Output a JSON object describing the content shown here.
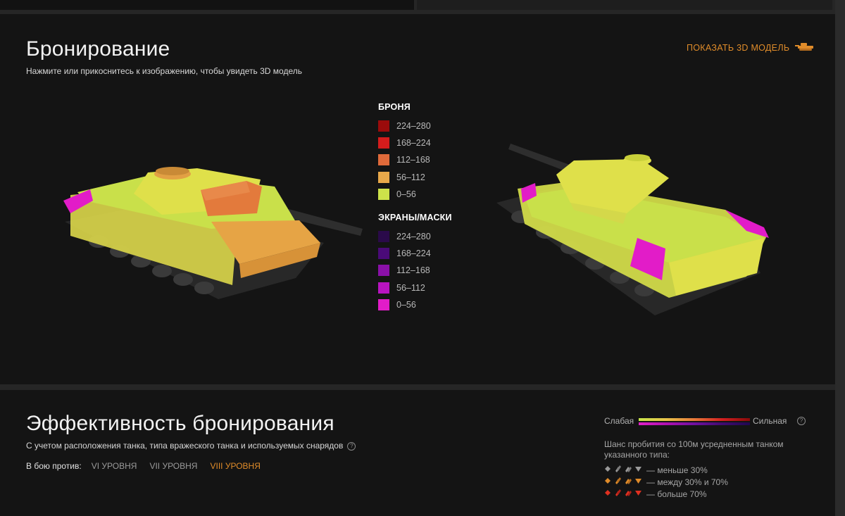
{
  "armor": {
    "title": "Бронирование",
    "subtitle": "Нажмите или прикоснитесь к изображению, чтобы увидеть 3D модель",
    "show_3d_label": "ПОКАЗАТЬ 3D МОДЕЛЬ",
    "legend_armor_title": "БРОНЯ",
    "legend_armor": [
      {
        "label": "224–280",
        "color": "#9b0b0b"
      },
      {
        "label": "168–224",
        "color": "#d41c1c"
      },
      {
        "label": "112–168",
        "color": "#e06a3a"
      },
      {
        "label": "56–112",
        "color": "#e8a84a"
      },
      {
        "label": "0–56",
        "color": "#cde24a"
      }
    ],
    "legend_screens_title": "ЭКРАНЫ/МАСКИ",
    "legend_screens": [
      {
        "label": "224–280",
        "color": "#2a0a4a"
      },
      {
        "label": "168–224",
        "color": "#4a0a78"
      },
      {
        "label": "112–168",
        "color": "#8a10a8"
      },
      {
        "label": "56–112",
        "color": "#b814c0"
      },
      {
        "label": "0–56",
        "color": "#e21cc8"
      }
    ]
  },
  "effectiveness": {
    "title": "Эффективность бронирования",
    "subtitle": "С учетом расположения танка, типа вражеского танка и используемых снарядов",
    "battle_vs_label": "В бою против:",
    "tiers": [
      "VI УРОВНЯ",
      "VII УРОВНЯ",
      "VIII УРОВНЯ"
    ],
    "active_tier": "VIII УРОВНЯ",
    "scale_weak": "Слабая",
    "scale_strong": "Сильная",
    "chance_text": "Шанс пробития со 100м усредненным танком указанного типа:",
    "chance_rows": [
      {
        "label": "— меньше 30%",
        "color": "#9a9a9a"
      },
      {
        "label": "— между 30% и 70%",
        "color": "#e08c2a"
      },
      {
        "label": "— больше 70%",
        "color": "#e03020"
      }
    ]
  }
}
